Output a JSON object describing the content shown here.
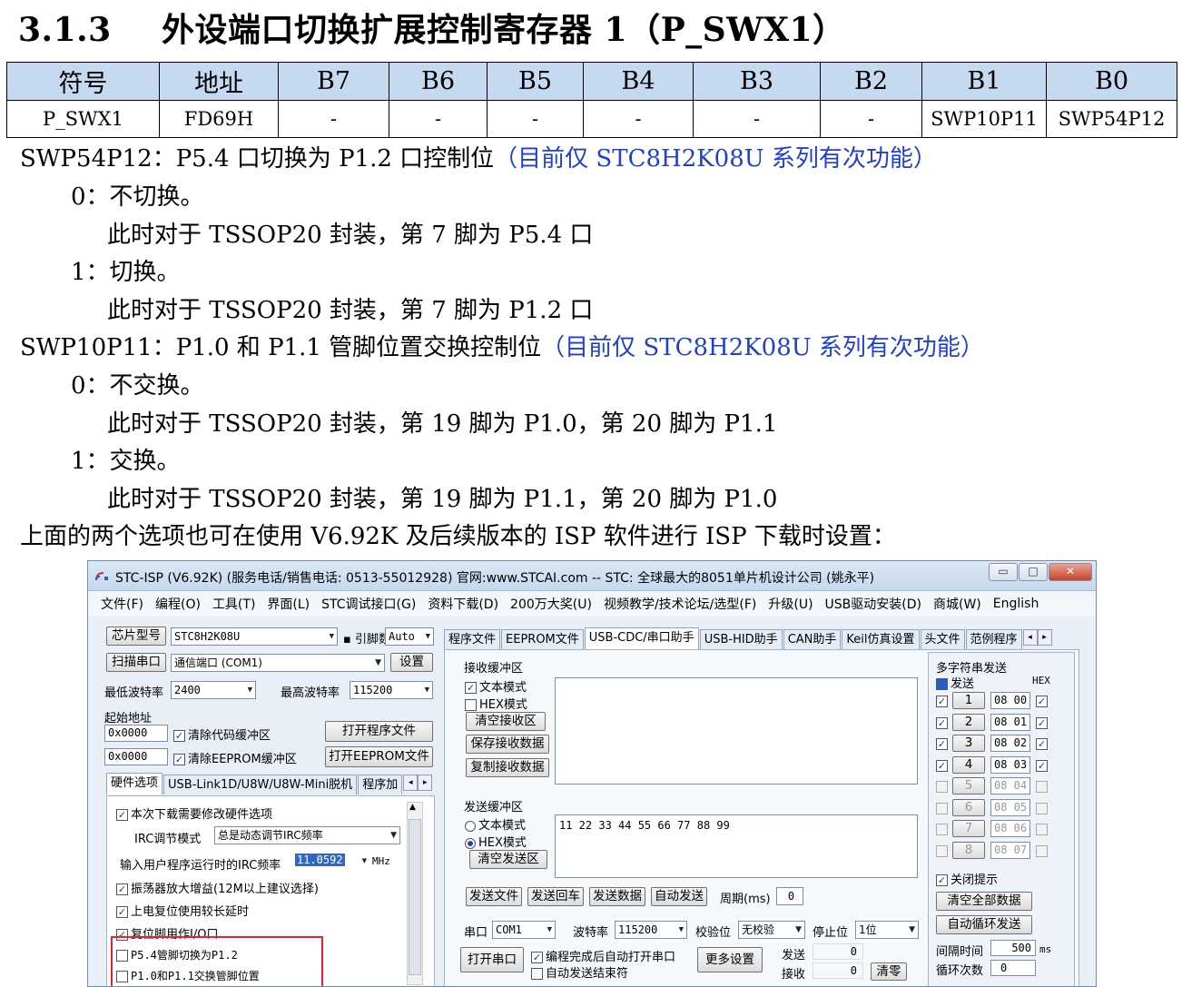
{
  "heading": {
    "number": "3.1.3",
    "title": "外设端口切换扩展控制寄存器 1（P_SWX1）"
  },
  "register_table": {
    "headers": [
      "符号",
      "地址",
      "B7",
      "B6",
      "B5",
      "B4",
      "B3",
      "B2",
      "B1",
      "B0"
    ],
    "values": [
      "P_SWX1",
      "FD69H",
      "-",
      "-",
      "-",
      "-",
      "-",
      "-",
      "SWP10P11",
      "SWP54P12"
    ]
  },
  "description": {
    "swp54": {
      "label": "SWP54P12：P5.4 口切换为 P1.2 口控制位",
      "note": "（目前仅 STC8H2K08U 系列有次功能）"
    },
    "swp54_0": "0：不切换。",
    "swp54_0_detail": "此时对于 TSSOP20 封装，第 7 脚为 P5.4 口",
    "swp54_1": "1：切换。",
    "swp54_1_detail": "此时对于 TSSOP20 封装，第 7 脚为 P1.2 口",
    "swp10": {
      "label": "SWP10P11：P1.0 和 P1.1 管脚位置交换控制位",
      "note": "（目前仅 STC8H2K08U 系列有次功能）"
    },
    "swp10_0": "0：不交换。",
    "swp10_0_detail": "此时对于 TSSOP20 封装，第 19 脚为 P1.0，第 20 脚为 P1.1",
    "swp10_1": "1：交换。",
    "swp10_1_detail": "此时对于 TSSOP20 封装，第 19 脚为 P1.1，第 20 脚为 P1.0",
    "footer": "上面的两个选项也可在使用 V6.92K 及后续版本的 ISP 软件进行 ISP 下载时设置："
  },
  "isp": {
    "title": "STC-ISP (V6.92K) (服务电话/销售电话: 0513-55012928) 官网:www.STCAI.com  -- STC: 全球最大的8051单片机设计公司 (姚永平)",
    "window_buttons": {
      "min": "▭",
      "max": "□",
      "close": "✕"
    },
    "menu": [
      "文件(F)",
      "编程(O)",
      "工具(T)",
      "界面(L)",
      "STC调试接口(G)",
      "资料下载(D)",
      "200万大奖(U)",
      "视频教学/技术论坛/选型(F)",
      "升级(U)",
      "USB驱动安装(D)",
      "商城(W)",
      "English"
    ],
    "left": {
      "chip_model_btn": "芯片型号",
      "chip_model": "STC8H2K08U",
      "pins_label": "引脚数",
      "pins": "Auto",
      "scan_btn": "扫描串口",
      "port": "通信端口 (COM1)",
      "settings_btn": "设置",
      "min_baud_label": "最低波特率",
      "min_baud": "2400",
      "max_baud_label": "最高波特率",
      "max_baud": "115200",
      "start_addr_label": "起始地址",
      "addr1": "0x0000",
      "clear_code": "清除代码缓冲区",
      "open_prog_btn": "打开程序文件",
      "addr2": "0x0000",
      "clear_eeprom": "清除EEPROM缓冲区",
      "open_eeprom_btn": "打开EEPROM文件",
      "tabs": [
        "硬件选项",
        "USB-Link1D/U8W/U8W-Mini脱机",
        "程序加"
      ],
      "opt_modify": "本次下载需要修改硬件选项",
      "irc_mode_label": "IRC调节模式",
      "irc_mode": "总是动态调节IRC频率",
      "irc_freq_label": "输入用户程序运行时的IRC频率",
      "irc_freq": "11.0592",
      "irc_unit": "MHz",
      "opt_osc": "振荡器放大增益(12M以上建议选择)",
      "opt_reset_delay": "上电复位使用较长延时",
      "opt_reset_io": "复位脚用作I/O口",
      "opt_p54": "P5.4管脚切换为P1.2",
      "opt_p10": "P1.0和P1.1交换管脚位置"
    },
    "mid": {
      "tabs": [
        "程序文件",
        "EEPROM文件",
        "USB-CDC/串口助手",
        "USB-HID助手",
        "CAN助手",
        "Keil仿真设置",
        "头文件",
        "范例程序"
      ],
      "rx_title": "接收缓冲区",
      "rx_text": "文本模式",
      "rx_hex": "HEX模式",
      "rx_clear": "清空接收区",
      "rx_save": "保存接收数据",
      "rx_copy": "复制接收数据",
      "tx_title": "发送缓冲区",
      "tx_text": "文本模式",
      "tx_hex": "HEX模式",
      "tx_clear": "清空发送区",
      "tx_content": "11 22 33 44 55 66 77 88 99",
      "send_file": "发送文件",
      "send_cr": "发送回车",
      "send_data": "发送数据",
      "auto_send": "自动发送",
      "period_label": "周期(ms)",
      "period": "0",
      "port_label": "串口",
      "port": "COM1",
      "baud_label": "波特率",
      "baud": "115200",
      "parity_label": "校验位",
      "parity": "无校验",
      "stop_label": "停止位",
      "stop": "1位",
      "open_port": "打开串口",
      "auto_open": "编程完成后自动打开串口",
      "auto_end": "自动发送结束符",
      "more_settings": "更多设置",
      "sent_label": "发送",
      "sent": "0",
      "recv_label": "接收",
      "recv": "0",
      "clear_count": "清零"
    },
    "right": {
      "title": "多字符串发送",
      "send_col": "发送",
      "hex_col": "HEX",
      "rows": [
        {
          "btn": "1",
          "val": "08 00"
        },
        {
          "btn": "2",
          "val": "08 01"
        },
        {
          "btn": "3",
          "val": "08 02"
        },
        {
          "btn": "4",
          "val": "08 03"
        },
        {
          "btn": "5",
          "val": "08 04"
        },
        {
          "btn": "6",
          "val": "08 05"
        },
        {
          "btn": "7",
          "val": "08 06"
        },
        {
          "btn": "8",
          "val": "08 07"
        }
      ],
      "close_hint": "关闭提示",
      "clear_all": "清空全部数据",
      "auto_loop": "自动循环发送",
      "interval_label": "间隔时间",
      "interval": "500",
      "interval_unit": "ms",
      "loop_label": "循环次数",
      "loop": "0"
    }
  }
}
